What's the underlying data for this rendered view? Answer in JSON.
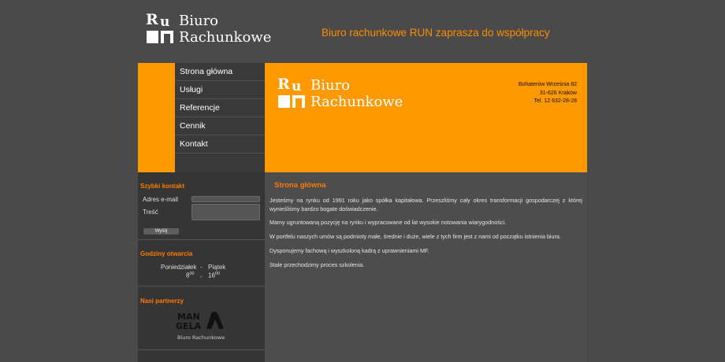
{
  "logo": {
    "line1": "Biuro",
    "line2": "Rachunkowe",
    "mark_letters": [
      "R",
      "u"
    ]
  },
  "header": {
    "tagline": "Biuro rachunkowe RUN zaprasza do współpracy"
  },
  "nav": {
    "items": [
      {
        "label": "Strona główna"
      },
      {
        "label": "Usługi"
      },
      {
        "label": "Referencje"
      },
      {
        "label": "Cennik"
      },
      {
        "label": "Kontakt"
      }
    ]
  },
  "address": {
    "street": "Bohaterów Września 82",
    "city": "31-626 Kraków",
    "phone": "Tel. 12 632-28-28"
  },
  "quick_contact": {
    "title": "Szybki kontakt",
    "email_label": "Adres e-mail",
    "email_value": "",
    "message_label": "Treść",
    "message_value": "",
    "send_label": "Wyślij"
  },
  "opening_hours": {
    "title": "Godziny otwarcia",
    "day_from": "Poniedziałek",
    "dash": "-",
    "day_to": "Piątek",
    "time_from_hour": "8",
    "time_from_min": "00",
    "time_to_hour": "16",
    "time_to_min": "00"
  },
  "partners": {
    "title": "Nasi partnerzy",
    "logo_text_top": "MAN",
    "logo_text_bottom": "GELA",
    "logo_caption": "Biuro Rachunkowe"
  },
  "main": {
    "title": "Strona główna",
    "paragraphs": [
      "Jesteśmy na rynku od 1991 roku jako spółka kapitałowa. Przeszliśmy cały okres transformacji gospodarczej z której wynieśliśmy bardzo bogate doświadczenie.",
      "Mamy ugruntowaną pozycję na rynku i wypracowane od lat wysokie notowania wiarygodności.",
      "W portfelu naszych umów są podmioty małe, średnie i duże, wiele z tych firm jest z nami od początku istnienia biura.",
      "Dysponujemy fachową i wyszkoloną kadrą z uprawnieniami MF.",
      "Stale przechodzimy proces szkolenia."
    ]
  },
  "colors": {
    "accent": "#ff9900",
    "title_orange": "#ff7a00",
    "page_bg": "#4a4a4a",
    "sidebar_bg": "#353535",
    "nav_bg": "#3a3a3a"
  }
}
